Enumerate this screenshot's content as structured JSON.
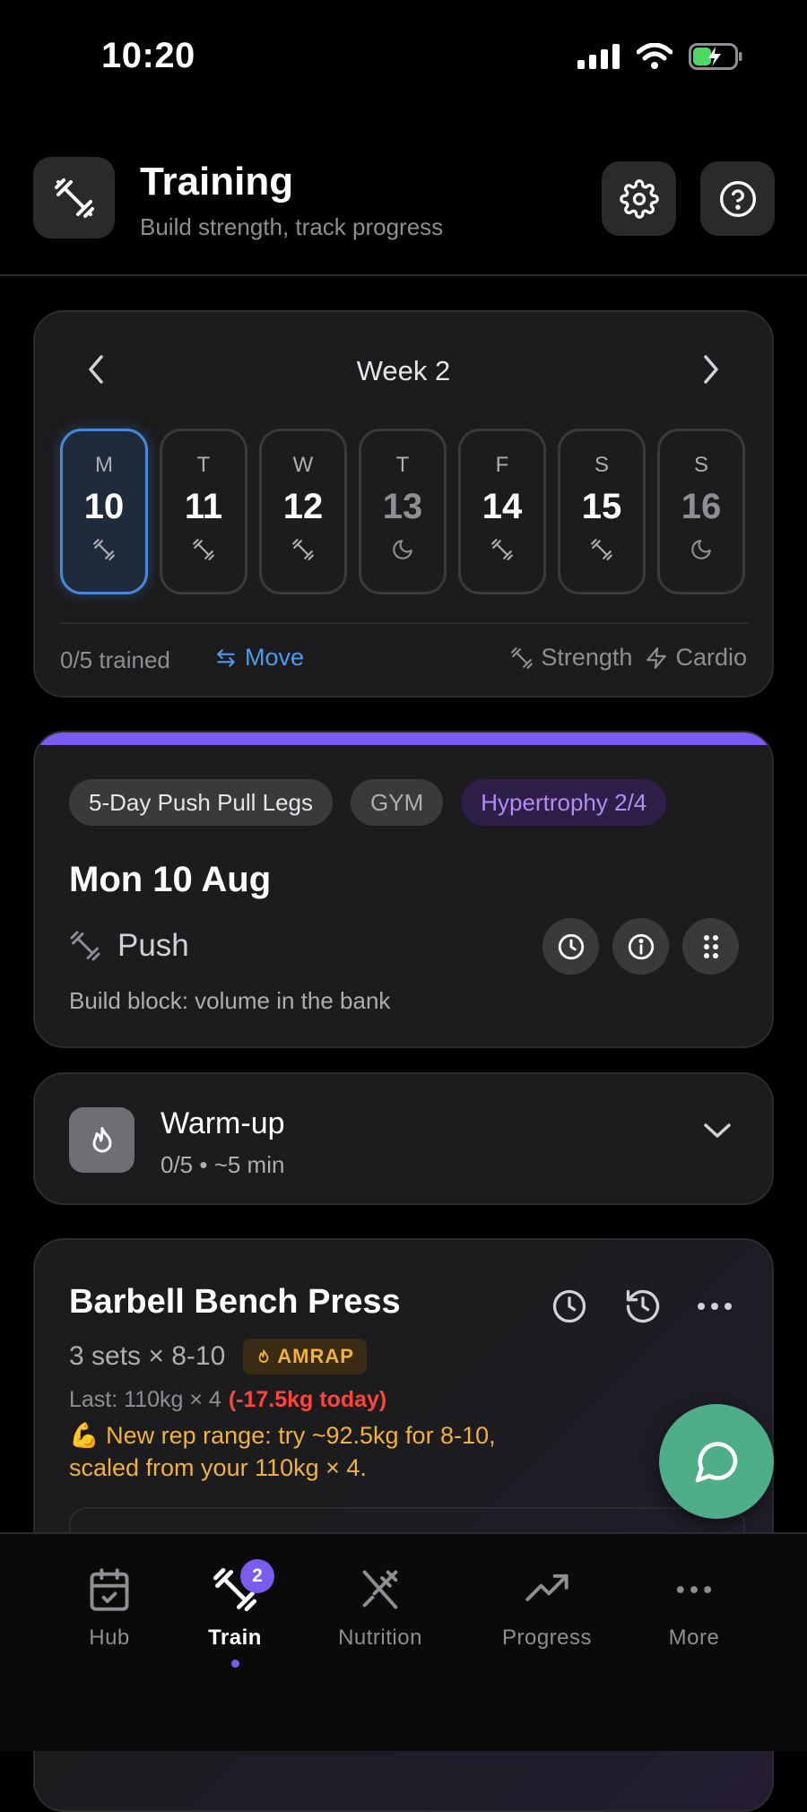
{
  "status": {
    "time": "10:20"
  },
  "header": {
    "title": "Training",
    "subtitle": "Build strength, track progress"
  },
  "week": {
    "title": "Week 2",
    "days": [
      {
        "letter": "M",
        "date": "10",
        "kind": "strength",
        "selected": true
      },
      {
        "letter": "T",
        "date": "11",
        "kind": "strength"
      },
      {
        "letter": "W",
        "date": "12",
        "kind": "strength"
      },
      {
        "letter": "T",
        "date": "13",
        "kind": "rest"
      },
      {
        "letter": "F",
        "date": "14",
        "kind": "strength"
      },
      {
        "letter": "S",
        "date": "15",
        "kind": "strength"
      },
      {
        "letter": "S",
        "date": "16",
        "kind": "rest"
      }
    ],
    "trained": "0/5 trained",
    "move_label": "Move",
    "legend_strength": "Strength",
    "legend_cardio": "Cardio"
  },
  "workout": {
    "tags": [
      "5-Day Push Pull Legs",
      "GYM",
      "Hypertrophy 2/4"
    ],
    "date": "Mon 10 Aug",
    "type": "Push",
    "description": "Build block: volume in the bank",
    "accent_color": "#7b5cf0"
  },
  "warmup": {
    "title": "Warm-up",
    "subtitle": "0/5 • ~5 min"
  },
  "exercise": {
    "name": "Barbell Bench Press",
    "sets": "3 sets × 8-10",
    "badge": "AMRAP",
    "last": "Last: 110kg × 4",
    "delta": "(-17.5kg today)",
    "tip": "💪 New rep range: try ~92.5kg for 8-10, scaled from your 110kg × 4."
  },
  "tabs": [
    {
      "label": "Hub"
    },
    {
      "label": "Train",
      "badge": "2",
      "active": true
    },
    {
      "label": "Nutrition"
    },
    {
      "label": "Progress"
    },
    {
      "label": "More"
    }
  ]
}
